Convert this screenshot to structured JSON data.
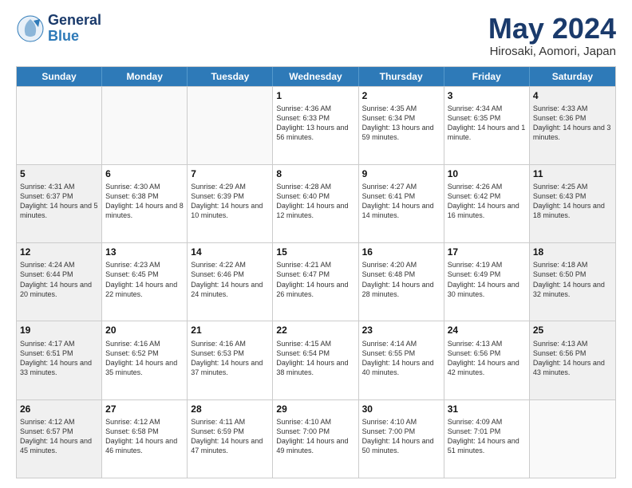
{
  "logo": {
    "line1": "General",
    "line2": "Blue"
  },
  "title": "May 2024",
  "subtitle": "Hirosaki, Aomori, Japan",
  "headers": [
    "Sunday",
    "Monday",
    "Tuesday",
    "Wednesday",
    "Thursday",
    "Friday",
    "Saturday"
  ],
  "rows": [
    [
      {
        "day": "",
        "empty": true
      },
      {
        "day": "",
        "empty": true
      },
      {
        "day": "",
        "empty": true
      },
      {
        "day": "1",
        "sunrise": "4:36 AM",
        "sunset": "6:33 PM",
        "daylight": "13 hours and 56 minutes."
      },
      {
        "day": "2",
        "sunrise": "4:35 AM",
        "sunset": "6:34 PM",
        "daylight": "13 hours and 59 minutes."
      },
      {
        "day": "3",
        "sunrise": "4:34 AM",
        "sunset": "6:35 PM",
        "daylight": "14 hours and 1 minute."
      },
      {
        "day": "4",
        "sunrise": "4:33 AM",
        "sunset": "6:36 PM",
        "daylight": "14 hours and 3 minutes."
      }
    ],
    [
      {
        "day": "5",
        "sunrise": "4:31 AM",
        "sunset": "6:37 PM",
        "daylight": "14 hours and 5 minutes."
      },
      {
        "day": "6",
        "sunrise": "4:30 AM",
        "sunset": "6:38 PM",
        "daylight": "14 hours and 8 minutes."
      },
      {
        "day": "7",
        "sunrise": "4:29 AM",
        "sunset": "6:39 PM",
        "daylight": "14 hours and 10 minutes."
      },
      {
        "day": "8",
        "sunrise": "4:28 AM",
        "sunset": "6:40 PM",
        "daylight": "14 hours and 12 minutes."
      },
      {
        "day": "9",
        "sunrise": "4:27 AM",
        "sunset": "6:41 PM",
        "daylight": "14 hours and 14 minutes."
      },
      {
        "day": "10",
        "sunrise": "4:26 AM",
        "sunset": "6:42 PM",
        "daylight": "14 hours and 16 minutes."
      },
      {
        "day": "11",
        "sunrise": "4:25 AM",
        "sunset": "6:43 PM",
        "daylight": "14 hours and 18 minutes."
      }
    ],
    [
      {
        "day": "12",
        "sunrise": "4:24 AM",
        "sunset": "6:44 PM",
        "daylight": "14 hours and 20 minutes."
      },
      {
        "day": "13",
        "sunrise": "4:23 AM",
        "sunset": "6:45 PM",
        "daylight": "14 hours and 22 minutes."
      },
      {
        "day": "14",
        "sunrise": "4:22 AM",
        "sunset": "6:46 PM",
        "daylight": "14 hours and 24 minutes."
      },
      {
        "day": "15",
        "sunrise": "4:21 AM",
        "sunset": "6:47 PM",
        "daylight": "14 hours and 26 minutes."
      },
      {
        "day": "16",
        "sunrise": "4:20 AM",
        "sunset": "6:48 PM",
        "daylight": "14 hours and 28 minutes."
      },
      {
        "day": "17",
        "sunrise": "4:19 AM",
        "sunset": "6:49 PM",
        "daylight": "14 hours and 30 minutes."
      },
      {
        "day": "18",
        "sunrise": "4:18 AM",
        "sunset": "6:50 PM",
        "daylight": "14 hours and 32 minutes."
      }
    ],
    [
      {
        "day": "19",
        "sunrise": "4:17 AM",
        "sunset": "6:51 PM",
        "daylight": "14 hours and 33 minutes."
      },
      {
        "day": "20",
        "sunrise": "4:16 AM",
        "sunset": "6:52 PM",
        "daylight": "14 hours and 35 minutes."
      },
      {
        "day": "21",
        "sunrise": "4:16 AM",
        "sunset": "6:53 PM",
        "daylight": "14 hours and 37 minutes."
      },
      {
        "day": "22",
        "sunrise": "4:15 AM",
        "sunset": "6:54 PM",
        "daylight": "14 hours and 38 minutes."
      },
      {
        "day": "23",
        "sunrise": "4:14 AM",
        "sunset": "6:55 PM",
        "daylight": "14 hours and 40 minutes."
      },
      {
        "day": "24",
        "sunrise": "4:13 AM",
        "sunset": "6:56 PM",
        "daylight": "14 hours and 42 minutes."
      },
      {
        "day": "25",
        "sunrise": "4:13 AM",
        "sunset": "6:56 PM",
        "daylight": "14 hours and 43 minutes."
      }
    ],
    [
      {
        "day": "26",
        "sunrise": "4:12 AM",
        "sunset": "6:57 PM",
        "daylight": "14 hours and 45 minutes."
      },
      {
        "day": "27",
        "sunrise": "4:12 AM",
        "sunset": "6:58 PM",
        "daylight": "14 hours and 46 minutes."
      },
      {
        "day": "28",
        "sunrise": "4:11 AM",
        "sunset": "6:59 PM",
        "daylight": "14 hours and 47 minutes."
      },
      {
        "day": "29",
        "sunrise": "4:10 AM",
        "sunset": "7:00 PM",
        "daylight": "14 hours and 49 minutes."
      },
      {
        "day": "30",
        "sunrise": "4:10 AM",
        "sunset": "7:00 PM",
        "daylight": "14 hours and 50 minutes."
      },
      {
        "day": "31",
        "sunrise": "4:09 AM",
        "sunset": "7:01 PM",
        "daylight": "14 hours and 51 minutes."
      },
      {
        "day": "",
        "empty": true
      }
    ]
  ]
}
